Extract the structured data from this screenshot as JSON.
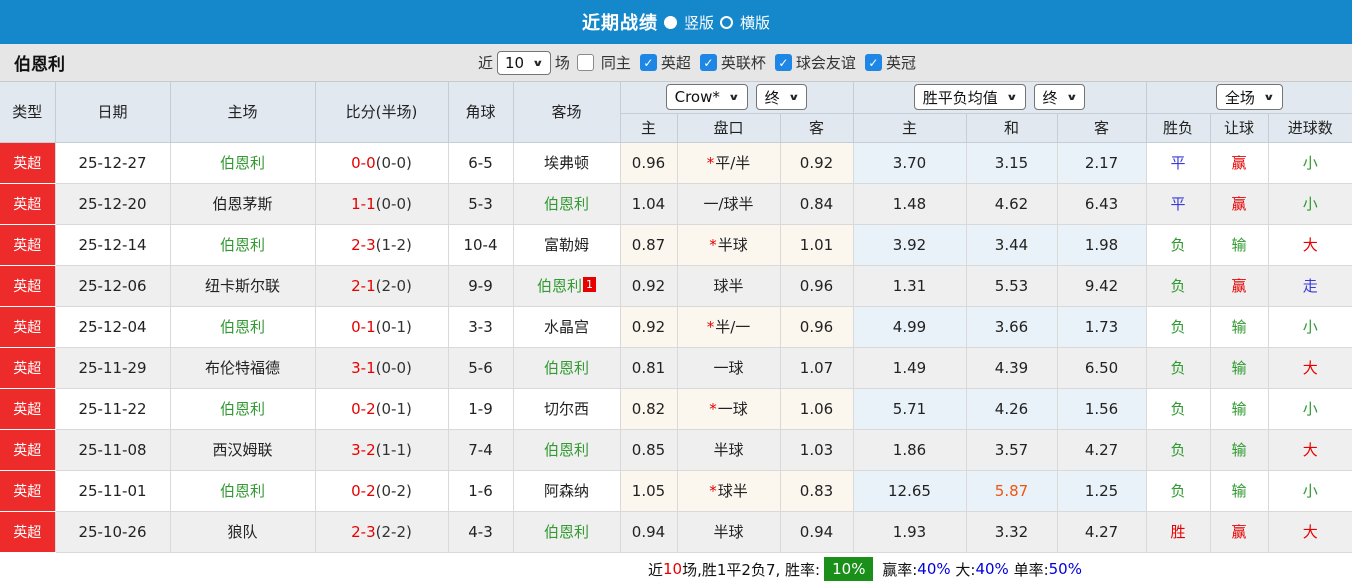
{
  "topbar": {
    "title": "近期战绩",
    "radios": [
      {
        "label": "竖版",
        "selected": true
      },
      {
        "label": "横版",
        "selected": false
      }
    ]
  },
  "filterbar": {
    "team": "伯恩利",
    "near_label": "近",
    "count_value": "10",
    "matches_label": "场",
    "same_home_label": "同主",
    "same_home_checked": false,
    "leagues": [
      {
        "label": "英超",
        "checked": true
      },
      {
        "label": "英联杯",
        "checked": true
      },
      {
        "label": "球会友谊",
        "checked": true
      },
      {
        "label": "英冠",
        "checked": true
      }
    ]
  },
  "icons": {
    "chevron_down": "∨",
    "check": "✓",
    "star": "*"
  },
  "table": {
    "headers": [
      "类型",
      "日期",
      "主场",
      "比分(半场)",
      "角球",
      "客场"
    ],
    "subheaders": [
      "主",
      "盘口",
      "客",
      "主",
      "和",
      "客",
      "胜负",
      "让球",
      "进球数"
    ],
    "dropdowns": {
      "bookmaker": "Crow*",
      "bookmaker_time": "终",
      "avg_label": "胜平负均值",
      "avg_time": "终",
      "scope": "全场"
    },
    "rows": [
      {
        "type": "英超",
        "date": "25-12-27",
        "home": "伯恩利",
        "home_self": true,
        "score": "0-0",
        "half": "(0-0)",
        "corners": "6-5",
        "away": "埃弗顿",
        "away_self": false,
        "away_badge": null,
        "odds_home": "0.96",
        "handicap_star": true,
        "handicap": "平/半",
        "odds_away": "0.92",
        "avg_home": "3.70",
        "avg_draw": "3.15",
        "avg_draw_highlight": false,
        "avg_away": "2.17",
        "result": {
          "text": "平",
          "color": "blue"
        },
        "give": {
          "text": "赢",
          "color": "red"
        },
        "goal": {
          "text": "小",
          "color": "green"
        }
      },
      {
        "type": "英超",
        "date": "25-12-20",
        "home": "伯恩茅斯",
        "home_self": false,
        "score": "1-1",
        "half": "(0-0)",
        "corners": "5-3",
        "away": "伯恩利",
        "away_self": true,
        "away_badge": null,
        "odds_home": "1.04",
        "handicap_star": false,
        "handicap": "一/球半",
        "odds_away": "0.84",
        "avg_home": "1.48",
        "avg_draw": "4.62",
        "avg_draw_highlight": false,
        "avg_away": "6.43",
        "result": {
          "text": "平",
          "color": "blue"
        },
        "give": {
          "text": "赢",
          "color": "red"
        },
        "goal": {
          "text": "小",
          "color": "green"
        }
      },
      {
        "type": "英超",
        "date": "25-12-14",
        "home": "伯恩利",
        "home_self": true,
        "score": "2-3",
        "half": "(1-2)",
        "corners": "10-4",
        "away": "富勒姆",
        "away_self": false,
        "away_badge": null,
        "odds_home": "0.87",
        "handicap_star": true,
        "handicap": "半球",
        "odds_away": "1.01",
        "avg_home": "3.92",
        "avg_draw": "3.44",
        "avg_draw_highlight": false,
        "avg_away": "1.98",
        "result": {
          "text": "负",
          "color": "green"
        },
        "give": {
          "text": "输",
          "color": "green"
        },
        "goal": {
          "text": "大",
          "color": "red"
        }
      },
      {
        "type": "英超",
        "date": "25-12-06",
        "home": "纽卡斯尔联",
        "home_self": false,
        "score": "2-1",
        "half": "(2-0)",
        "corners": "9-9",
        "away": "伯恩利",
        "away_self": true,
        "away_badge": "1",
        "odds_home": "0.92",
        "handicap_star": false,
        "handicap": "球半",
        "odds_away": "0.96",
        "avg_home": "1.31",
        "avg_draw": "5.53",
        "avg_draw_highlight": false,
        "avg_away": "9.42",
        "result": {
          "text": "负",
          "color": "green"
        },
        "give": {
          "text": "赢",
          "color": "red"
        },
        "goal": {
          "text": "走",
          "color": "blue"
        }
      },
      {
        "type": "英超",
        "date": "25-12-04",
        "home": "伯恩利",
        "home_self": true,
        "score": "0-1",
        "half": "(0-1)",
        "corners": "3-3",
        "away": "水晶宫",
        "away_self": false,
        "away_badge": null,
        "odds_home": "0.92",
        "handicap_star": true,
        "handicap": "半/一",
        "odds_away": "0.96",
        "avg_home": "4.99",
        "avg_draw": "3.66",
        "avg_draw_highlight": false,
        "avg_away": "1.73",
        "result": {
          "text": "负",
          "color": "green"
        },
        "give": {
          "text": "输",
          "color": "green"
        },
        "goal": {
          "text": "小",
          "color": "green"
        }
      },
      {
        "type": "英超",
        "date": "25-11-29",
        "home": "布伦特福德",
        "home_self": false,
        "score": "3-1",
        "half": "(0-0)",
        "corners": "5-6",
        "away": "伯恩利",
        "away_self": true,
        "away_badge": null,
        "odds_home": "0.81",
        "handicap_star": false,
        "handicap": "一球",
        "odds_away": "1.07",
        "avg_home": "1.49",
        "avg_draw": "4.39",
        "avg_draw_highlight": false,
        "avg_away": "6.50",
        "result": {
          "text": "负",
          "color": "green"
        },
        "give": {
          "text": "输",
          "color": "green"
        },
        "goal": {
          "text": "大",
          "color": "red"
        }
      },
      {
        "type": "英超",
        "date": "25-11-22",
        "home": "伯恩利",
        "home_self": true,
        "score": "0-2",
        "half": "(0-1)",
        "corners": "1-9",
        "away": "切尔西",
        "away_self": false,
        "away_badge": null,
        "odds_home": "0.82",
        "handicap_star": true,
        "handicap": "一球",
        "odds_away": "1.06",
        "avg_home": "5.71",
        "avg_draw": "4.26",
        "avg_draw_highlight": false,
        "avg_away": "1.56",
        "result": {
          "text": "负",
          "color": "green"
        },
        "give": {
          "text": "输",
          "color": "green"
        },
        "goal": {
          "text": "小",
          "color": "green"
        }
      },
      {
        "type": "英超",
        "date": "25-11-08",
        "home": "西汉姆联",
        "home_self": false,
        "score": "3-2",
        "half": "(1-1)",
        "corners": "7-4",
        "away": "伯恩利",
        "away_self": true,
        "away_badge": null,
        "odds_home": "0.85",
        "handicap_star": false,
        "handicap": "半球",
        "odds_away": "1.03",
        "avg_home": "1.86",
        "avg_draw": "3.57",
        "avg_draw_highlight": false,
        "avg_away": "4.27",
        "result": {
          "text": "负",
          "color": "green"
        },
        "give": {
          "text": "输",
          "color": "green"
        },
        "goal": {
          "text": "大",
          "color": "red"
        }
      },
      {
        "type": "英超",
        "date": "25-11-01",
        "home": "伯恩利",
        "home_self": true,
        "score": "0-2",
        "half": "(0-2)",
        "corners": "1-6",
        "away": "阿森纳",
        "away_self": false,
        "away_badge": null,
        "odds_home": "1.05",
        "handicap_star": true,
        "handicap": "球半",
        "odds_away": "0.83",
        "avg_home": "12.65",
        "avg_draw": "5.87",
        "avg_draw_highlight": true,
        "avg_away": "1.25",
        "result": {
          "text": "负",
          "color": "green"
        },
        "give": {
          "text": "输",
          "color": "green"
        },
        "goal": {
          "text": "小",
          "color": "green"
        }
      },
      {
        "type": "英超",
        "date": "25-10-26",
        "home": "狼队",
        "home_self": false,
        "score": "2-3",
        "half": "(2-2)",
        "corners": "4-3",
        "away": "伯恩利",
        "away_self": true,
        "away_badge": null,
        "odds_home": "0.94",
        "handicap_star": false,
        "handicap": "半球",
        "odds_away": "0.94",
        "avg_home": "1.93",
        "avg_draw": "3.32",
        "avg_draw_highlight": false,
        "avg_away": "4.27",
        "result": {
          "text": "胜",
          "color": "red"
        },
        "give": {
          "text": "赢",
          "color": "red"
        },
        "goal": {
          "text": "大",
          "color": "red"
        }
      }
    ]
  },
  "footer": {
    "segments": [
      {
        "text": "近",
        "style": "",
        "name": "summary-near-label"
      },
      {
        "text": "10",
        "style": "c-red",
        "name": "summary-match-count"
      },
      {
        "text": "场,胜1平2负7, 胜率:",
        "style": "",
        "name": "summary-record-text"
      },
      {
        "text": "10%",
        "style": "pct-badge",
        "name": "win-rate-badge"
      },
      {
        "text": " 赢率:",
        "style": "",
        "name": "handicap-rate-label"
      },
      {
        "text": "40%",
        "style": "c-link",
        "name": "handicap-rate-value"
      },
      {
        "text": " 大:",
        "style": "",
        "name": "over-rate-label"
      },
      {
        "text": "40%",
        "style": "c-link",
        "name": "over-rate-value"
      },
      {
        "text": " 单率:",
        "style": "",
        "name": "odd-rate-label"
      },
      {
        "text": "50%",
        "style": "c-link",
        "name": "odd-rate-value"
      }
    ]
  },
  "colors": {
    "accent_blue": "#1587cb",
    "checkbox_blue": "#1e87e5",
    "league_red": "#ee2b2b",
    "self_team_green": "#339933",
    "score_red": "#e60000",
    "win_red": "#e60000",
    "lose_green": "#2f9a2f",
    "draw_blue": "#3a3ad8",
    "highlight_orange": "#f05410",
    "rate_green_bg": "#1a8f1a",
    "stat_blue": "#0000dd"
  }
}
